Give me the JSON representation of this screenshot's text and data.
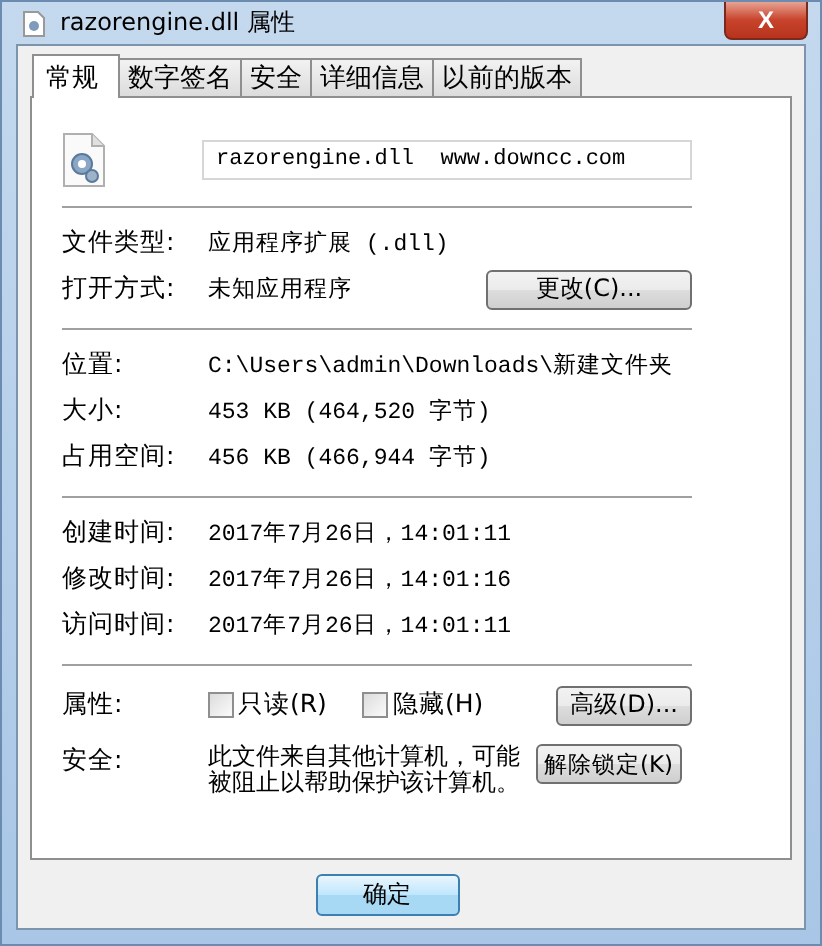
{
  "window": {
    "title": "razorengine.dll 属性",
    "close": "X"
  },
  "tabs": [
    {
      "label": "常规",
      "selected": true
    },
    {
      "label": "数字签名",
      "selected": false
    },
    {
      "label": "安全",
      "selected": false
    },
    {
      "label": "详细信息",
      "selected": false
    },
    {
      "label": "以前的版本",
      "selected": false
    }
  ],
  "file_name": {
    "value": "razorengine.dll  www.downcc.com"
  },
  "groups": [
    [
      {
        "label": "文件类型:",
        "value": "应用程序扩展 (.dll)"
      },
      {
        "label": "打开方式:",
        "value": "未知应用程序",
        "button": "更改(C)..."
      }
    ],
    [
      {
        "label": "位置:",
        "value": "C:\\Users\\admin\\Downloads\\新建文件夹"
      },
      {
        "label": "大小:",
        "value": "453 KB (464,520 字节)"
      },
      {
        "label": "占用空间:",
        "value": "456 KB (466,944 字节)"
      }
    ],
    [
      {
        "label": "创建时间:",
        "value": "2017年7月26日，14:01:11"
      },
      {
        "label": "修改时间:",
        "value": "2017年7月26日，14:01:16"
      },
      {
        "label": "访问时间:",
        "value": "2017年7月26日，14:01:11"
      }
    ]
  ],
  "attributes": {
    "label": "属性:",
    "checkboxes": [
      {
        "label": "只读(R)",
        "checked": false
      },
      {
        "label": "隐藏(H)",
        "checked": false
      }
    ],
    "button": "高级(D)..."
  },
  "security": {
    "label": "安全:",
    "text": "此文件来自其他计算机，可能被阻止以帮助保护该计算机。",
    "button": "解除锁定(K)"
  },
  "buttons": [
    "确定"
  ]
}
